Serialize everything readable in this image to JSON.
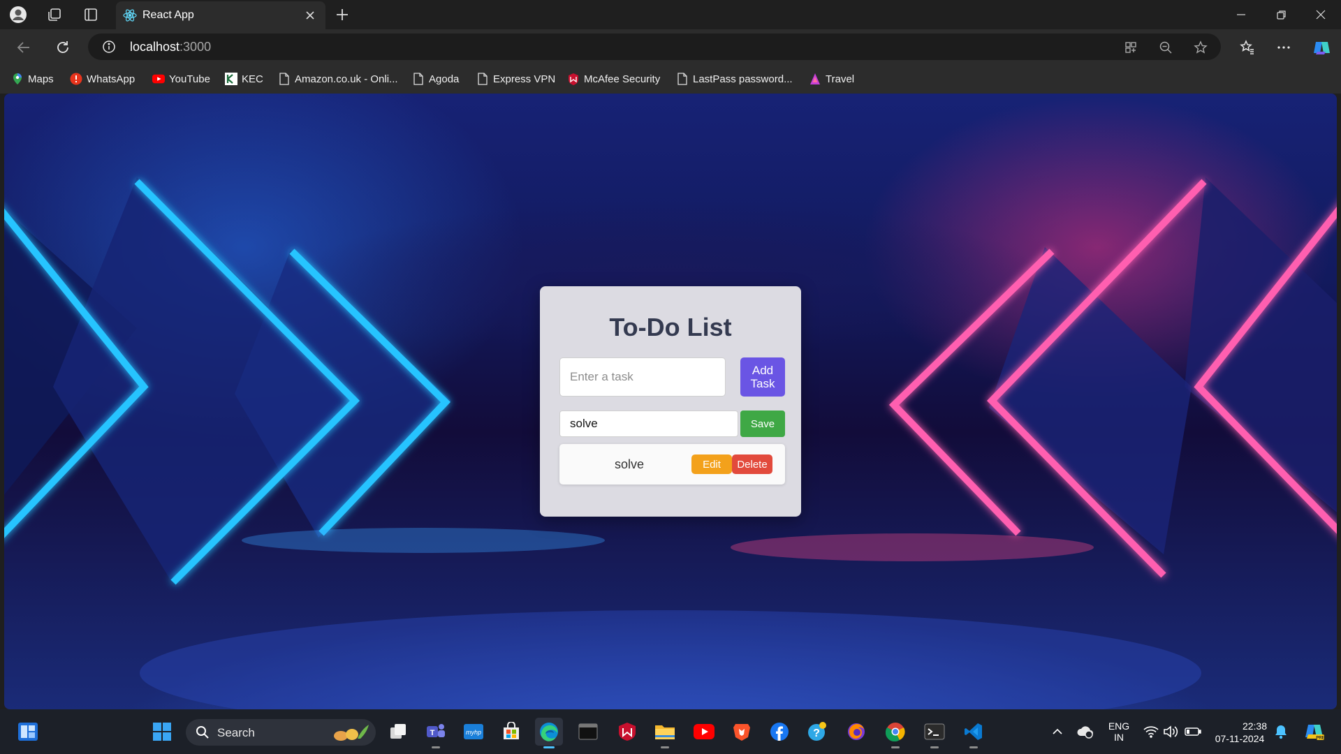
{
  "browser": {
    "tab_title": "React App",
    "address": {
      "host": "localhost",
      "port": ":3000"
    }
  },
  "bookmarks": [
    {
      "label": "Maps",
      "icon": "maps-pin-icon"
    },
    {
      "label": "WhatsApp",
      "icon": "whatsapp-icon"
    },
    {
      "label": "YouTube",
      "icon": "youtube-icon"
    },
    {
      "label": "KEC",
      "icon": "kec-icon"
    },
    {
      "label": "Amazon.co.uk - Onli...",
      "icon": "page-icon"
    },
    {
      "label": "Agoda",
      "icon": "page-icon"
    },
    {
      "label": "Express VPN",
      "icon": "page-icon"
    },
    {
      "label": "McAfee Security",
      "icon": "mcafee-icon"
    },
    {
      "label": "LastPass password...",
      "icon": "page-icon"
    },
    {
      "label": "Travel",
      "icon": "travel-icon"
    }
  ],
  "todo": {
    "title": "To-Do List",
    "input_placeholder": "Enter a task",
    "add_button": "Add Task",
    "edit_value": "solve",
    "save_button": "Save",
    "tasks": [
      {
        "text": "solve",
        "edit_label": "Edit",
        "delete_label": "Delete"
      }
    ]
  },
  "taskbar": {
    "search_label": "Search",
    "lang_line1": "ENG",
    "lang_line2": "IN",
    "time": "22:38",
    "date": "07-11-2024"
  },
  "colors": {
    "add_button": "#6a55e4",
    "save_button": "#3fa845",
    "edit_button": "#f3a11b",
    "delete_button": "#e24a3c",
    "card_bg": "#dcdbe2"
  }
}
